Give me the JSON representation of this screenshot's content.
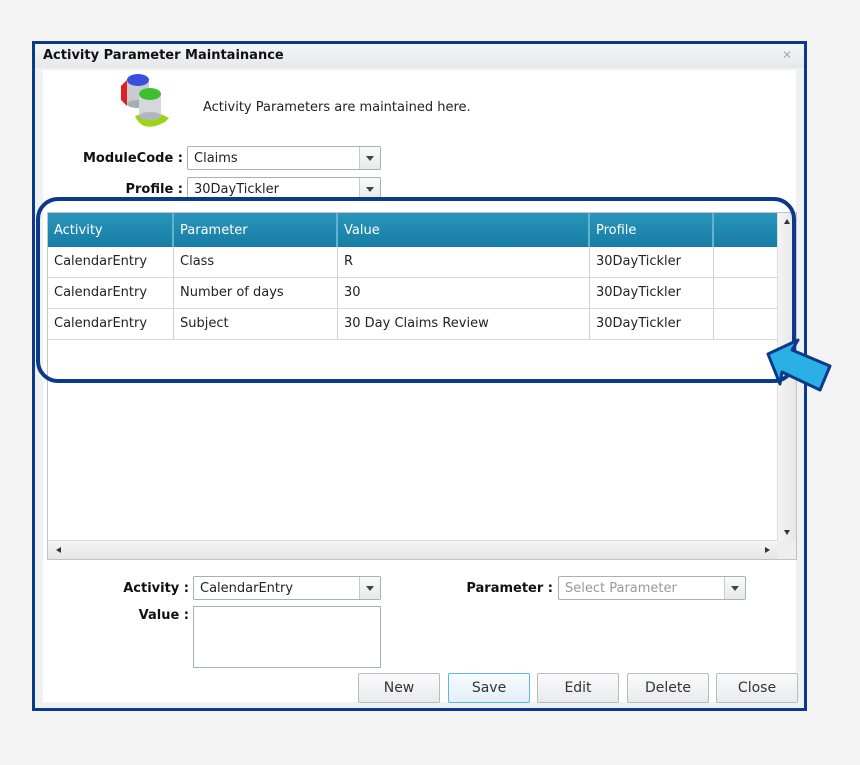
{
  "window": {
    "title": "Activity Parameter Maintainance",
    "close_icon": "close-x-icon"
  },
  "header": {
    "logo_icon": "database-cylinders-icon",
    "intro_text": "Activity Parameters are maintained here."
  },
  "filters": {
    "module_code_label": "ModuleCode :",
    "module_code_value": "Claims",
    "profile_label": "Profile :",
    "profile_value": "30DayTickler"
  },
  "grid": {
    "columns": [
      "Activity",
      "Parameter",
      "Value",
      "Profile",
      ""
    ],
    "rows": [
      [
        "CalendarEntry",
        "Class",
        "R",
        "30DayTickler",
        ""
      ],
      [
        "CalendarEntry",
        "Number of days",
        "30",
        "30DayTickler",
        ""
      ],
      [
        "CalendarEntry",
        "Subject",
        "30 Day Claims Review",
        "30DayTickler",
        ""
      ]
    ]
  },
  "form": {
    "activity_label": "Activity :",
    "activity_value": "CalendarEntry",
    "parameter_label": "Parameter :",
    "parameter_placeholder": "Select Parameter",
    "value_label": "Value :",
    "value_text": ""
  },
  "buttons": {
    "new": "New",
    "save": "Save",
    "edit": "Edit",
    "delete": "Delete",
    "close": "Close"
  },
  "annotation": {
    "highlight_color": "#0c3a8a",
    "pointer_color": "#2bb0e6"
  }
}
